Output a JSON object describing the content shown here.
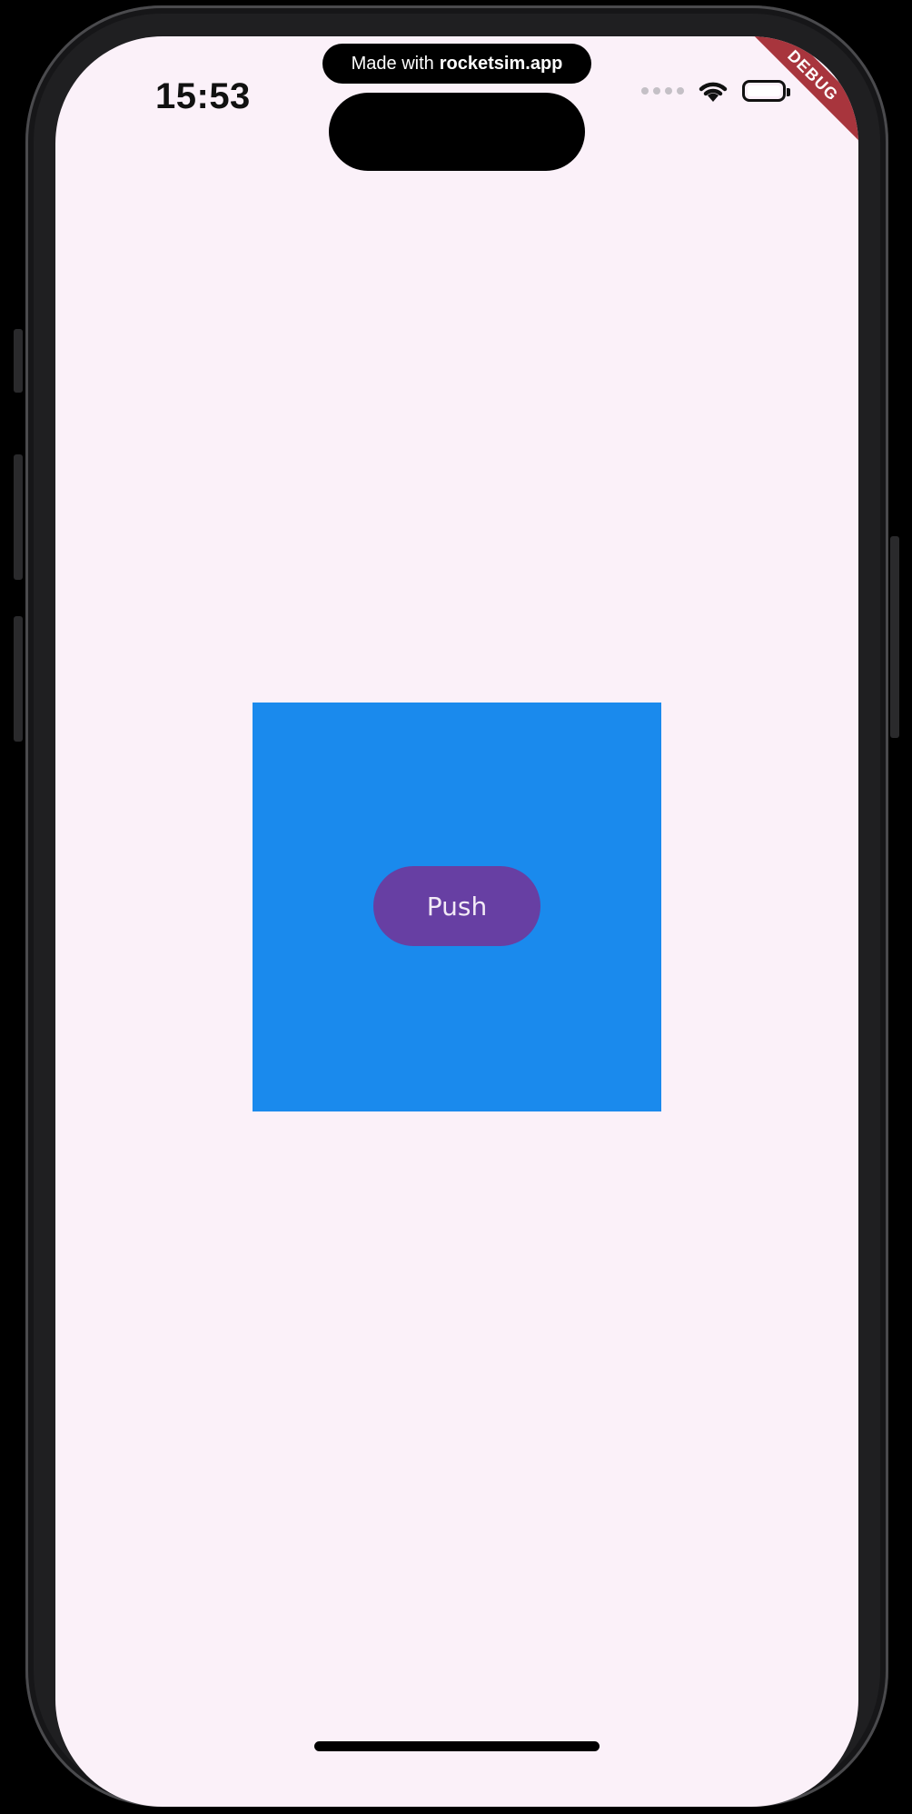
{
  "status_bar": {
    "time": "15:53",
    "signal_icon": "cellular-signal-icon",
    "wifi_icon": "wifi-icon",
    "battery_icon": "battery-icon"
  },
  "banner": {
    "prefix": "Made with",
    "brand": "rocketsim.app"
  },
  "debug_ribbon": {
    "label": "DEBUG",
    "color": "#a8353d"
  },
  "main": {
    "box_color": "#1a8aed",
    "push_button_label": "Push",
    "push_button_color": "#673fa3"
  },
  "theme": {
    "screen_background": "#fbf1f9"
  }
}
